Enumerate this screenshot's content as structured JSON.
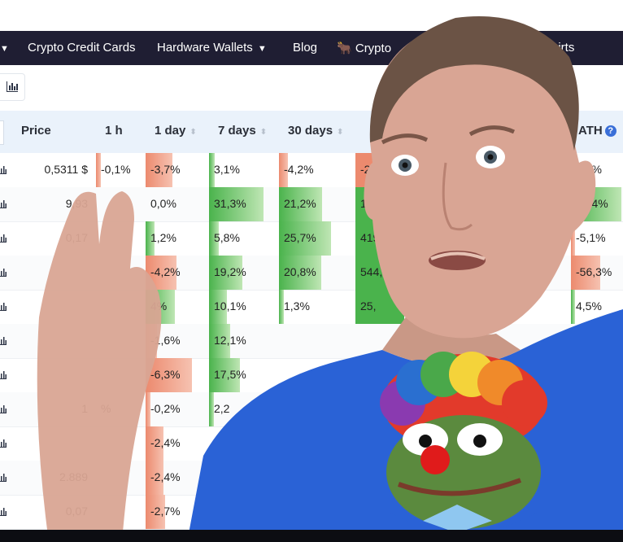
{
  "nav": {
    "items": [
      {
        "label": "",
        "caret": "▼"
      },
      {
        "label": "Crypto Credit Cards",
        "caret": ""
      },
      {
        "label": "Hardware Wallets",
        "caret": "▼"
      },
      {
        "label": "Blog",
        "caret": ""
      },
      {
        "label": "Crypto",
        "caret": ""
      },
      {
        "label": "Shirts",
        "caret": ""
      }
    ]
  },
  "table": {
    "headers": {
      "price": "Price",
      "h1": "1 h",
      "d1": "1 day",
      "d7": "7 days",
      "d30": "30 days",
      "ath": "ATH"
    },
    "sort_glyph": "⬍",
    "help_glyph": "?",
    "rows": [
      {
        "price": "0,5311 $",
        "h1": "-0,1%",
        "d1": "-3,7%",
        "d7": "3,1%",
        "d30": "-4,2%",
        "ath": "1,5%"
      },
      {
        "price": "9,93",
        "h1": "",
        "d1": "0,0%",
        "d7": "31,3%",
        "d30": "21,2%",
        "ath": "97,4%"
      },
      {
        "price": "0,17",
        "h1": "",
        "d1": "1,2%",
        "d7": "5,8%",
        "d30": "25,7%",
        "ath": "-5,1%"
      },
      {
        "price": "",
        "h1": "",
        "d1": "-4,2%",
        "d7": "19,2%",
        "d30": "20,8%",
        "ath": "-56,3%"
      },
      {
        "price": "",
        "h1": "",
        "d1": "4%",
        "d7": "10,1%",
        "d30": "1,3%",
        "ath": "4,5%"
      },
      {
        "price": "",
        "h1": "",
        "d1": "-1,6%",
        "d7": "12,1%",
        "d30": "",
        "ath": ""
      },
      {
        "price": "",
        "h1": "",
        "d1": "-6,3%",
        "d7": "17,5%",
        "d30": "",
        "ath": ""
      },
      {
        "price": "1",
        "h1": "%",
        "d1": "-0,2%",
        "d7": "2,2",
        "d30": "",
        "ath": ""
      },
      {
        "price": "",
        "h1": "",
        "d1": "-2,4%",
        "d7": "",
        "d30": "",
        "ath": ""
      },
      {
        "price": "2.889",
        "h1": "",
        "d1": "-2,4%",
        "d7": "",
        "d30": "",
        "ath": ""
      },
      {
        "price": "0,07",
        "h1": "",
        "d1": "-2,7%",
        "d7": "",
        "d30": "",
        "ath": ""
      }
    ],
    "partial_30d_extra": [
      "-2",
      "14",
      "419,",
      "544,5",
      "25,"
    ]
  },
  "colors": {
    "nav_bg": "#1f1e33",
    "header_bg": "#eaf2fb",
    "neg": "#ec8a6e",
    "neg_light": "#f6c2b1",
    "pos": "#4ab34c",
    "pos_light": "#bfe6b4",
    "shirt": "#2a62d6"
  },
  "icons": {
    "chart": "bar-chart-icon",
    "sparkline": "mini-chart-icon"
  }
}
